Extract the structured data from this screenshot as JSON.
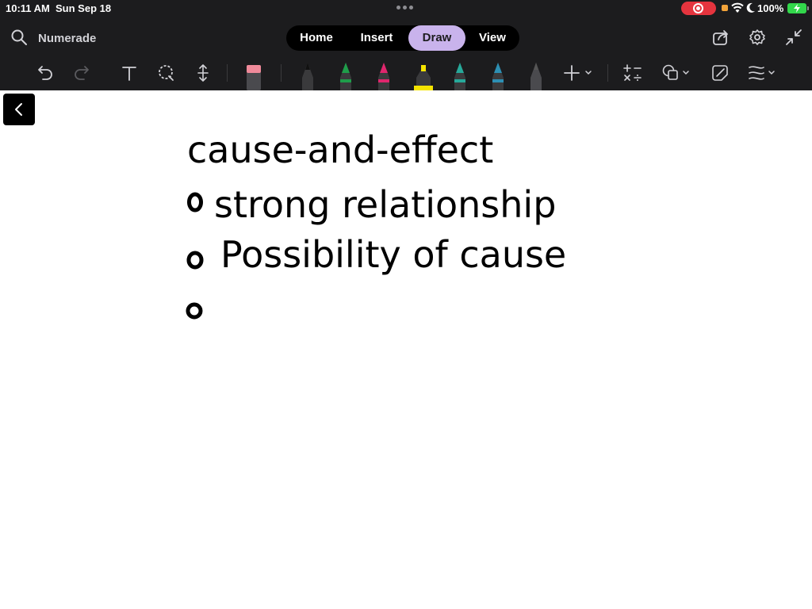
{
  "status_bar": {
    "time": "10:11 AM",
    "date": "Sun Sep 18",
    "battery": "100%",
    "icons": [
      "more-dots-icon",
      "screen-record-icon",
      "wifi-icon",
      "moon-icon",
      "battery-charging-icon"
    ]
  },
  "nav": {
    "app_name": "Numerade",
    "tabs": [
      {
        "label": "Home",
        "active": false
      },
      {
        "label": "Insert",
        "active": false
      },
      {
        "label": "Draw",
        "active": true
      },
      {
        "label": "View",
        "active": false
      }
    ],
    "right_icons": [
      "share-icon",
      "settings-gear-icon",
      "collapse-icon"
    ]
  },
  "toolbar": {
    "tools": [
      "undo-icon",
      "redo-icon",
      "text-tool-icon",
      "lasso-tool-icon",
      "insert-space-icon",
      "eraser-icon"
    ],
    "pens": [
      {
        "name": "pen-black",
        "color": "#111111"
      },
      {
        "name": "pen-green",
        "color": "#1f9d4a"
      },
      {
        "name": "pen-pink",
        "color": "#e0266d"
      },
      {
        "name": "highlighter-yellow",
        "color": "#f5e400"
      },
      {
        "name": "pen-teal",
        "color": "#27a99a"
      },
      {
        "name": "pen-blue",
        "color": "#2d8fb3"
      },
      {
        "name": "pen-gray",
        "color": "#555555"
      }
    ],
    "extra_tools": [
      "add-pen-icon",
      "math-icon",
      "shapes-icon",
      "ink-to-shape-icon",
      "ruler-icon"
    ]
  },
  "canvas": {
    "lines": [
      "cause-and-effect",
      "strong relationship",
      "Possibility of cause",
      ""
    ],
    "ink_color": "#000000"
  },
  "colors": {
    "chrome": "#1c1c1e",
    "active_tab": "#c9b3ec",
    "record": "#e5343e",
    "battery": "#32d74b"
  }
}
